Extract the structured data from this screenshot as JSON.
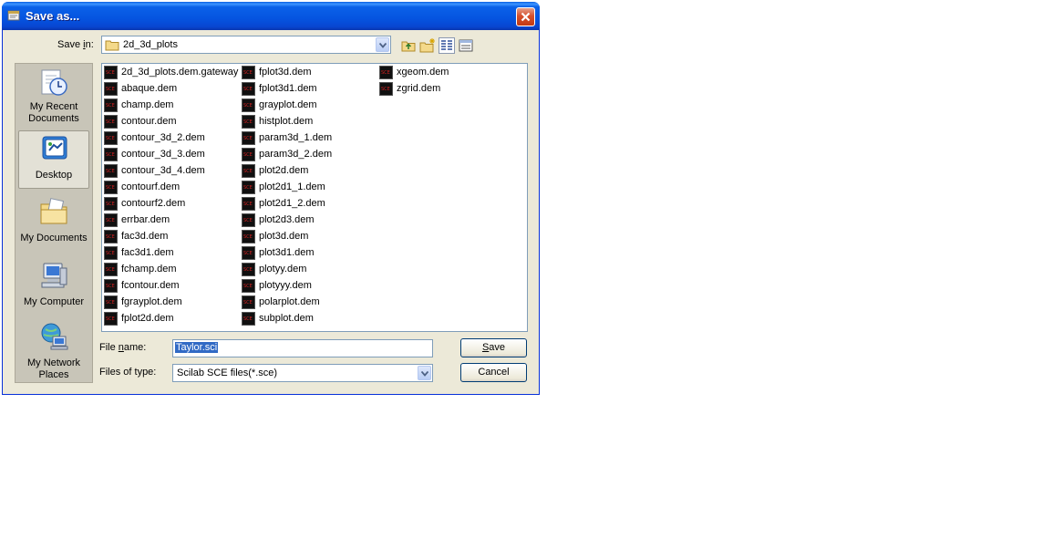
{
  "window": {
    "title": "Save as...",
    "close_icon": "close-x-icon",
    "accent_color": "#0554e0"
  },
  "save_in": {
    "label_pre": "Save ",
    "label_u": "i",
    "label_post": "n:",
    "value": "2d_3d_plots",
    "icon": "folder-icon"
  },
  "toolbar": {
    "buttons": [
      "up-one-level-icon",
      "new-folder-icon",
      "list-view-icon",
      "details-view-icon"
    ]
  },
  "places": [
    {
      "label": "My Recent Documents",
      "icon": "recent-documents-icon"
    },
    {
      "label": "Desktop",
      "icon": "desktop-icon",
      "selected": true
    },
    {
      "label": "My Documents",
      "icon": "my-documents-icon"
    },
    {
      "label": "My Computer",
      "icon": "my-computer-icon"
    },
    {
      "label": "My Network Places",
      "icon": "network-places-icon"
    }
  ],
  "files": {
    "icon_text": "SCE",
    "col1": [
      "2d_3d_plots.dem.gateway",
      "abaque.dem",
      "champ.dem",
      "contour.dem",
      "contour_3d_2.dem",
      "contour_3d_3.dem",
      "contour_3d_4.dem",
      "contourf.dem",
      "contourf2.dem",
      "errbar.dem",
      "fac3d.dem",
      "fac3d1.dem",
      "fchamp.dem",
      "fcontour.dem",
      "fgrayplot.dem",
      "fplot2d.dem"
    ],
    "col2": [
      "fplot3d.dem",
      "fplot3d1.dem",
      "grayplot.dem",
      "histplot.dem",
      "param3d_1.dem",
      "param3d_2.dem",
      "plot2d.dem",
      "plot2d1_1.dem",
      "plot2d1_2.dem",
      "plot2d3.dem",
      "plot3d.dem",
      "plot3d1.dem",
      "plotyy.dem",
      "plotyyy.dem",
      "polarplot.dem",
      "subplot.dem"
    ],
    "col3": [
      "xgeom.dem",
      "zgrid.dem"
    ]
  },
  "file_name": {
    "label_pre": "File ",
    "label_u": "n",
    "label_post": "ame:",
    "value": "Taylor.sci"
  },
  "file_type": {
    "label": "Files of type:",
    "value": "Scilab SCE files(*.sce)"
  },
  "buttons": {
    "save_u": "S",
    "save_rest": "ave",
    "cancel": "Cancel"
  }
}
